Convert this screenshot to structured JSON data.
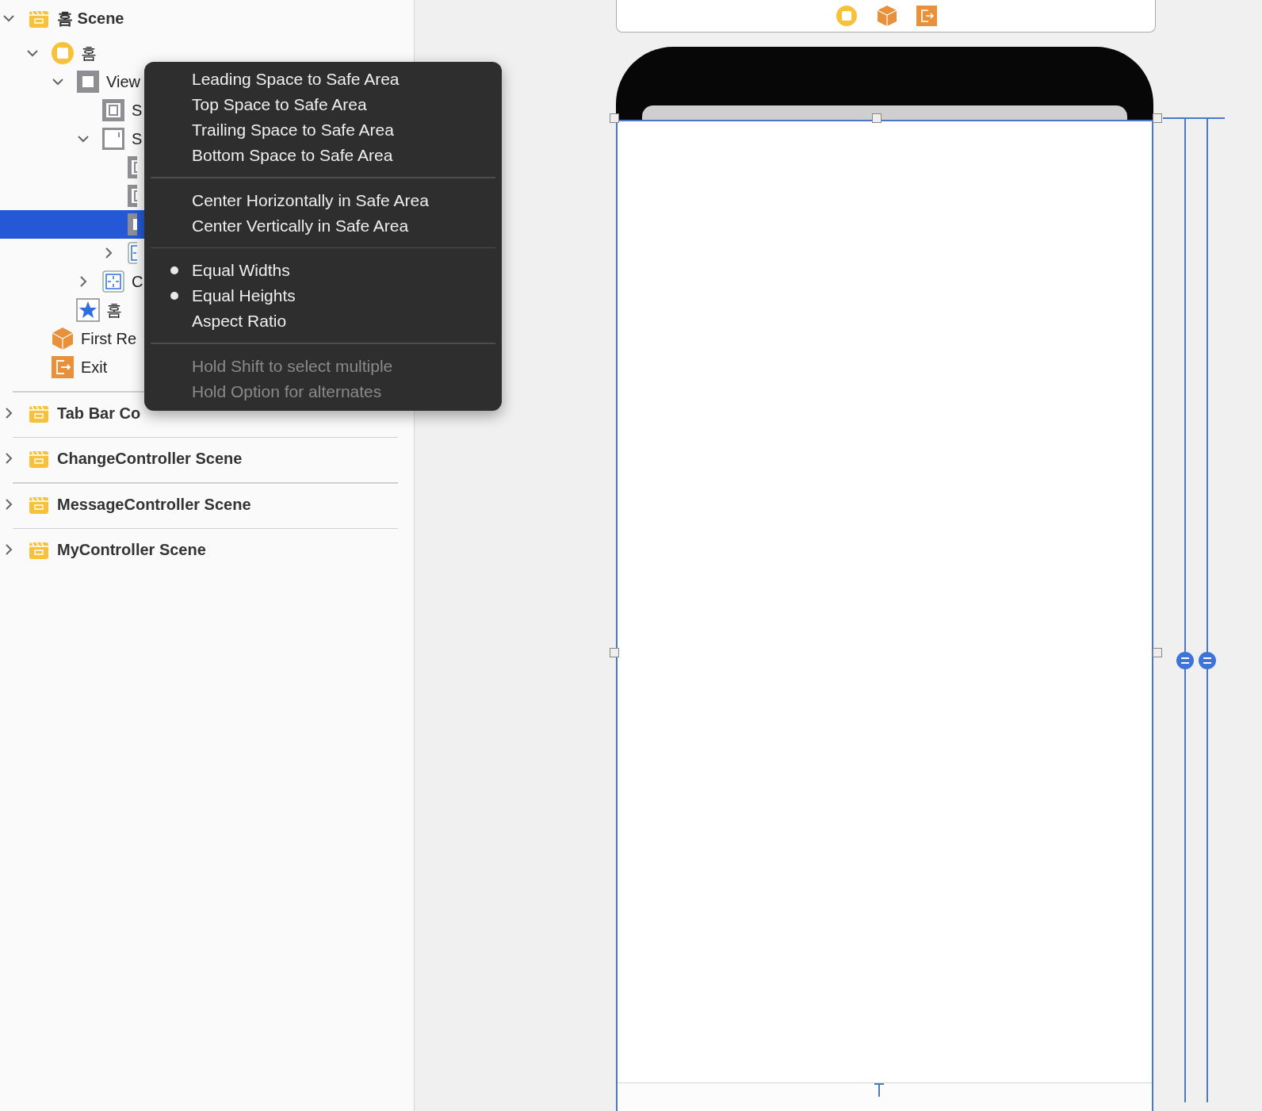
{
  "outline": [
    {
      "label": "홈 Scene",
      "kind": "scene",
      "expanded": true,
      "selected": false,
      "children": [
        {
          "label": "홈",
          "kind": "controller",
          "expanded": true,
          "selected": false,
          "children": [
            {
              "label": "View",
              "kind": "view",
              "expanded": true,
              "selected": false,
              "children": [
                {
                  "label": "S",
                  "kind": "guide",
                  "selected": false
                },
                {
                  "label": "S",
                  "kind": "scrollview",
                  "expanded": true,
                  "selected": false,
                  "children": [
                    {
                      "kind": "guide",
                      "selected": false
                    },
                    {
                      "kind": "guide",
                      "selected": false
                    },
                    {
                      "kind": "view",
                      "selected": true
                    },
                    {
                      "kind": "constraints",
                      "expanded": false,
                      "selected": false
                    }
                  ]
                },
                {
                  "label": "C",
                  "kind": "constraints",
                  "expanded": false,
                  "selected": false
                }
              ]
            },
            {
              "label": "홈",
              "kind": "tabitem",
              "selected": false
            }
          ]
        },
        {
          "label": "First Re",
          "kind": "responder",
          "selected": false
        },
        {
          "label": "Exit",
          "kind": "exit",
          "selected": false
        }
      ]
    },
    {
      "label": "Tab Bar Co",
      "kind": "scene",
      "expanded": false,
      "selected": false
    },
    {
      "label": "ChangeController Scene",
      "kind": "scene",
      "expanded": false,
      "selected": false
    },
    {
      "label": "MessageController Scene",
      "kind": "scene",
      "expanded": false,
      "selected": false
    },
    {
      "label": "MyController Scene",
      "kind": "scene",
      "expanded": false,
      "selected": false
    }
  ],
  "context_menu": {
    "sections": [
      {
        "items": [
          {
            "label": "Leading Space to Safe Area",
            "checked": false,
            "disabled": false
          },
          {
            "label": "Top Space to Safe Area",
            "checked": false,
            "disabled": false
          },
          {
            "label": "Trailing Space to Safe Area",
            "checked": false,
            "disabled": false
          },
          {
            "label": "Bottom Space to Safe Area",
            "checked": false,
            "disabled": false
          }
        ]
      },
      {
        "items": [
          {
            "label": "Center Horizontally in Safe Area",
            "checked": false,
            "disabled": false
          },
          {
            "label": "Center Vertically in Safe Area",
            "checked": false,
            "disabled": false
          }
        ]
      },
      {
        "items": [
          {
            "label": "Equal Widths",
            "checked": true,
            "disabled": false
          },
          {
            "label": "Equal Heights",
            "checked": true,
            "disabled": false
          },
          {
            "label": "Aspect Ratio",
            "checked": false,
            "disabled": false
          }
        ]
      },
      {
        "items": [
          {
            "label": "Hold Shift to select multiple",
            "checked": false,
            "disabled": true
          },
          {
            "label": "Hold Option for alternates",
            "checked": false,
            "disabled": true
          }
        ]
      }
    ]
  }
}
